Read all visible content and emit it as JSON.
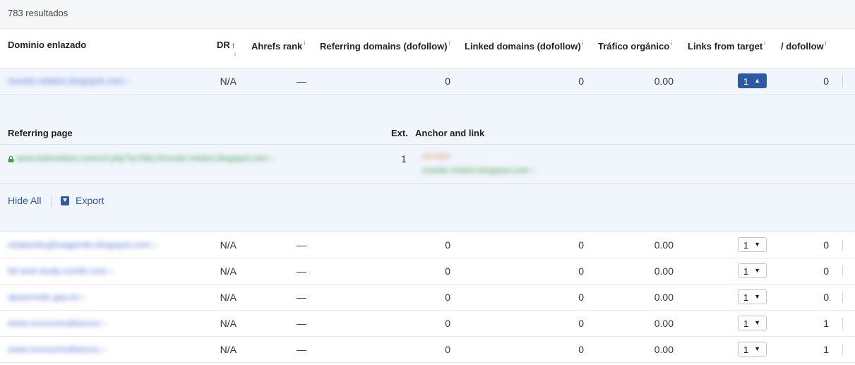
{
  "results": {
    "count_label": "783 resultados"
  },
  "columns": {
    "domain": "Dominio enlazado",
    "dr": "DR",
    "ahrefs_rank": "Ahrefs rank",
    "referring_domains": "Referring domains (dofollow)",
    "linked_domains": "Linked domains (dofollow)",
    "traffic": "Tráfico orgánico",
    "links_from_target": "Links from target",
    "dofollow": "/ dofollow",
    "info_glyph": "i",
    "sort_glyph": "↑"
  },
  "rows": [
    {
      "domain": "mundo-relatos.blogspot.com",
      "dr": "N/A",
      "rank": "—",
      "ref_domains": "0",
      "linked_domains": "0",
      "traffic": "0.00",
      "links": "1",
      "dofollow": "0",
      "expanded": true
    },
    {
      "domain": "relatandoyjhoagendo.blogspot.com",
      "dr": "N/A",
      "rank": "—",
      "ref_domains": "0",
      "linked_domains": "0",
      "traffic": "0.00",
      "links": "1",
      "dofollow": "0",
      "expanded": false
    },
    {
      "domain": "bit-and-study.zumbi.com",
      "dr": "N/A",
      "rank": "—",
      "ref_domains": "0",
      "linked_domains": "0",
      "traffic": "0.00",
      "links": "1",
      "dofollow": "0",
      "expanded": false
    },
    {
      "domain": "apasmodo.gay.es",
      "dr": "N/A",
      "rank": "—",
      "ref_domains": "0",
      "linked_domains": "0",
      "traffic": "0.00",
      "links": "1",
      "dofollow": "0",
      "expanded": false
    },
    {
      "domain": "www.xxxxxxmultiasxxx",
      "dr": "N/A",
      "rank": "—",
      "ref_domains": "0",
      "linked_domains": "0",
      "traffic": "0.00",
      "links": "1",
      "dofollow": "1",
      "expanded": false
    },
    {
      "domain": "www.xxxxxxmultiasxxx",
      "dr": "N/A",
      "rank": "—",
      "ref_domains": "0",
      "linked_domains": "0",
      "traffic": "0.00",
      "links": "1",
      "dofollow": "1",
      "expanded": false
    }
  ],
  "expanded": {
    "headers": {
      "referring_page": "Referring page",
      "ext": "Ext.",
      "anchor": "Anchor and link"
    },
    "ref_page_url": "www.todorelatos.com/url.php?q=http://mundo-relatos.blogspot.com",
    "ext": "1",
    "anchor_text": "dondeé",
    "anchor_url": "mundo-relatos.blogspot.com",
    "hide_all_label": "Hide All",
    "export_label": "Export"
  },
  "icons": {
    "caret_up": "▲",
    "caret_down": "▼",
    "chevron": "›"
  }
}
